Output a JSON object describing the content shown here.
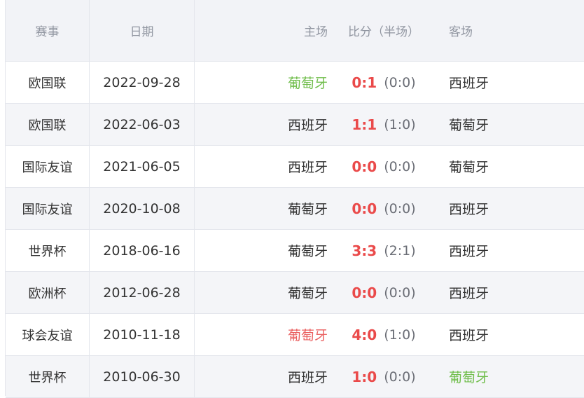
{
  "header": {
    "competition": "赛事",
    "date": "日期",
    "home": "主场",
    "score": "比分（半场）",
    "away": "客场"
  },
  "colors": {
    "win": "#6fbd4a",
    "lose": "#ea6060",
    "score": "#ea4a4a",
    "header_bg": "#f2f3f7"
  },
  "matches": [
    {
      "competition": "欧国联",
      "date": "2022-09-28",
      "home": "葡萄牙",
      "score": "0:1",
      "half": "(0:0)",
      "away": "西班牙",
      "home_status": "win",
      "away_status": "normal"
    },
    {
      "competition": "欧国联",
      "date": "2022-06-03",
      "home": "西班牙",
      "score": "1:1",
      "half": "(1:0)",
      "away": "葡萄牙",
      "home_status": "normal",
      "away_status": "normal"
    },
    {
      "competition": "国际友谊",
      "date": "2021-06-05",
      "home": "西班牙",
      "score": "0:0",
      "half": "(0:0)",
      "away": "葡萄牙",
      "home_status": "normal",
      "away_status": "normal"
    },
    {
      "competition": "国际友谊",
      "date": "2020-10-08",
      "home": "葡萄牙",
      "score": "0:0",
      "half": "(0:0)",
      "away": "西班牙",
      "home_status": "normal",
      "away_status": "normal"
    },
    {
      "competition": "世界杯",
      "date": "2018-06-16",
      "home": "葡萄牙",
      "score": "3:3",
      "half": "(2:1)",
      "away": "西班牙",
      "home_status": "normal",
      "away_status": "normal"
    },
    {
      "competition": "欧洲杯",
      "date": "2012-06-28",
      "home": "葡萄牙",
      "score": "0:0",
      "half": "(0:0)",
      "away": "西班牙",
      "home_status": "normal",
      "away_status": "normal"
    },
    {
      "competition": "球会友谊",
      "date": "2010-11-18",
      "home": "葡萄牙",
      "score": "4:0",
      "half": "(1:0)",
      "away": "西班牙",
      "home_status": "lose",
      "away_status": "normal"
    },
    {
      "competition": "世界杯",
      "date": "2010-06-30",
      "home": "西班牙",
      "score": "1:0",
      "half": "(0:0)",
      "away": "葡萄牙",
      "home_status": "normal",
      "away_status": "win"
    }
  ]
}
